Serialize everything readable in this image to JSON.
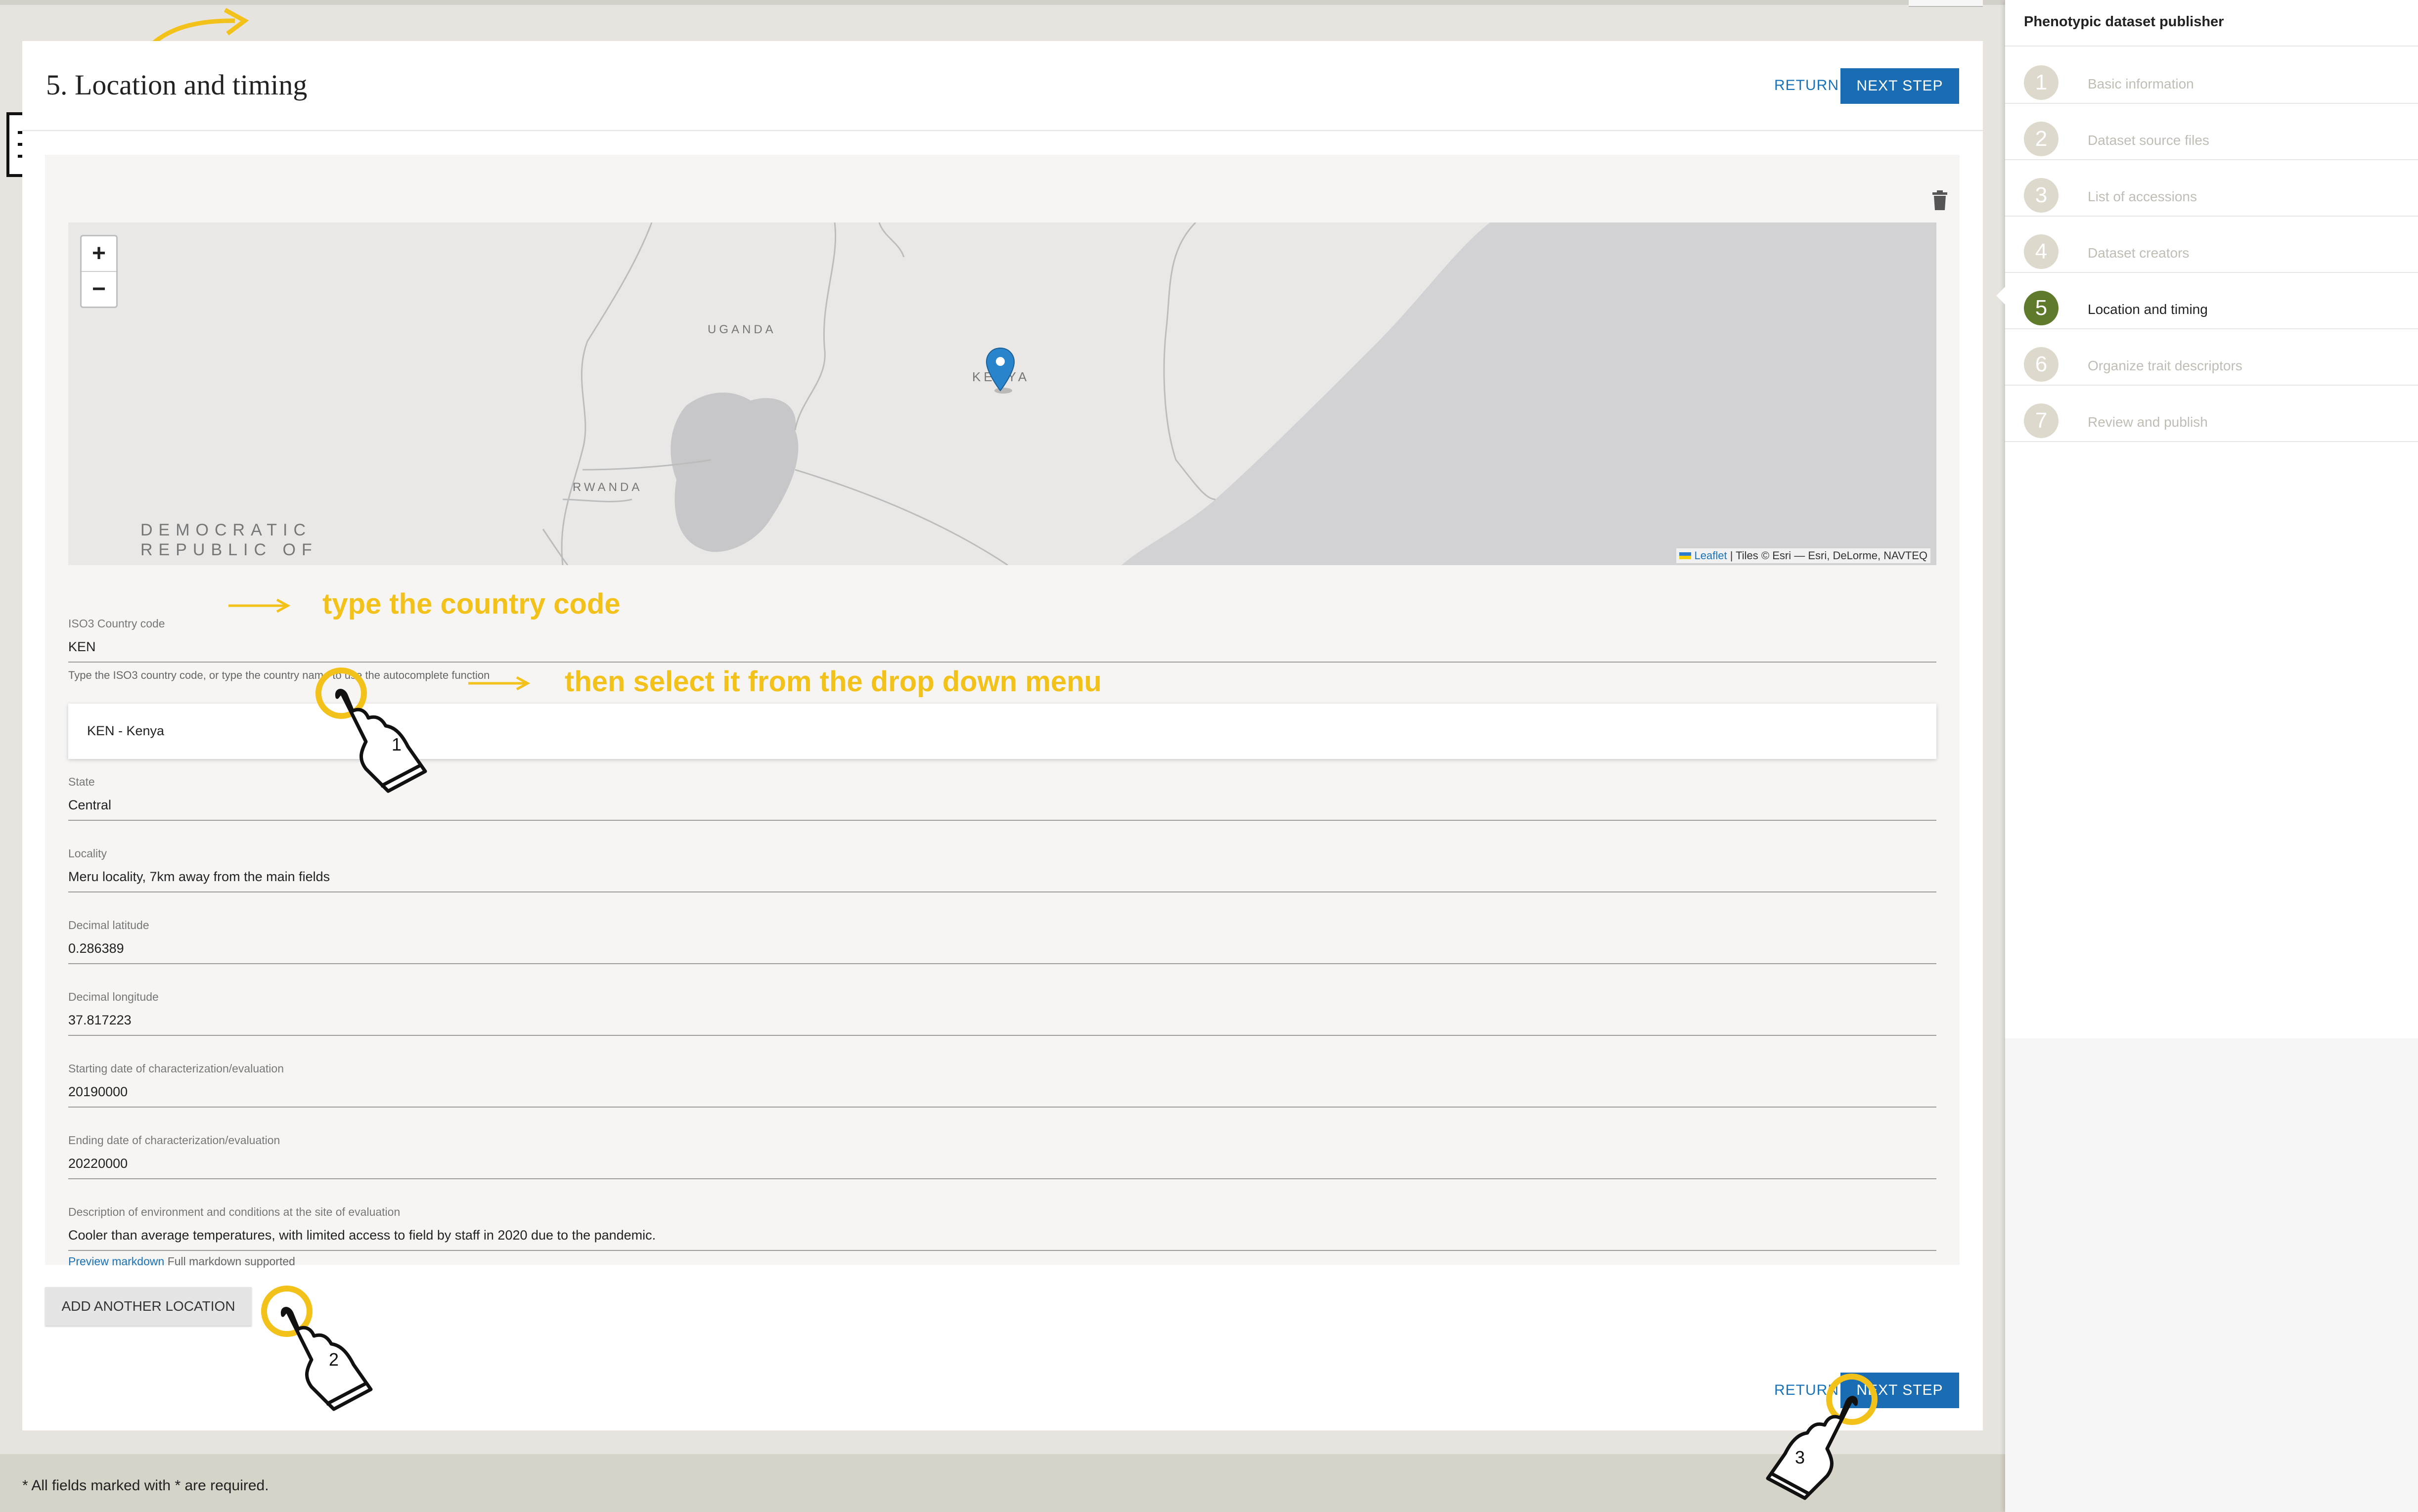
{
  "header": {
    "title": "5. Location and timing",
    "return_label": "RETURN",
    "next_label": "NEXT STEP"
  },
  "map": {
    "zoom_in": "+",
    "zoom_out": "−",
    "labels": {
      "uganda": "UGANDA",
      "kenya": "KENYA",
      "rwanda": "RWANDA",
      "drc_line1": "DEMOCRATIC",
      "drc_line2": "REPUBLIC OF"
    },
    "attribution_leaflet": "Leaflet",
    "attribution_rest": "| Tiles © Esri — Esri, DeLorme, NAVTEQ"
  },
  "form": {
    "country": {
      "label": "ISO3 Country code",
      "value": "KEN",
      "helper": "Type the ISO3 country code, or type the country name to use the autocomplete function"
    },
    "dropdown_option": "KEN - Kenya",
    "state": {
      "label": "State",
      "value": "Central"
    },
    "locality": {
      "label": "Locality",
      "value": "Meru locality, 7km away from the main fields"
    },
    "latitude": {
      "label": "Decimal latitude",
      "value": "0.286389"
    },
    "longitude": {
      "label": "Decimal longitude",
      "value": "37.817223"
    },
    "start_date": {
      "label": "Starting date of characterization/evaluation",
      "value": "20190000"
    },
    "end_date": {
      "label": "Ending date of characterization/evaluation",
      "value": "20220000"
    },
    "description": {
      "label": "Description of environment and conditions at the site of evaluation",
      "value": "Cooler than average temperatures, with limited access to field by staff in 2020 due to the pandemic."
    },
    "preview_markdown": "Preview markdown",
    "markdown_note": "Full markdown supported"
  },
  "add_location_label": "ADD ANOTHER LOCATION",
  "footer": {
    "required_note": "* All fields marked with * are required."
  },
  "sidebar": {
    "title": "Phenotypic dataset publisher",
    "steps": [
      {
        "num": "1",
        "label": "Basic information"
      },
      {
        "num": "2",
        "label": "Dataset source files"
      },
      {
        "num": "3",
        "label": "List of accessions"
      },
      {
        "num": "4",
        "label": "Dataset creators"
      },
      {
        "num": "5",
        "label": "Location and timing"
      },
      {
        "num": "6",
        "label": "Organize trait descriptors"
      },
      {
        "num": "7",
        "label": "Review and publish"
      }
    ],
    "active_step": 5
  },
  "annotations": {
    "type_country": "type the country code",
    "select_dropdown": "then select it from the drop down menu",
    "hand_1": "1",
    "hand_2": "2",
    "hand_3": "3"
  },
  "colors": {
    "accent": "#1a6db3",
    "annotation": "#f3c21a",
    "active_step": "#5f7a2a",
    "inactive_step": "#ddd9cc"
  },
  "icons": [
    "trash-icon",
    "map-marker-icon",
    "document-icon",
    "delete-bin-icon",
    "pointing-hand-icon",
    "arrow-right-icon"
  ]
}
